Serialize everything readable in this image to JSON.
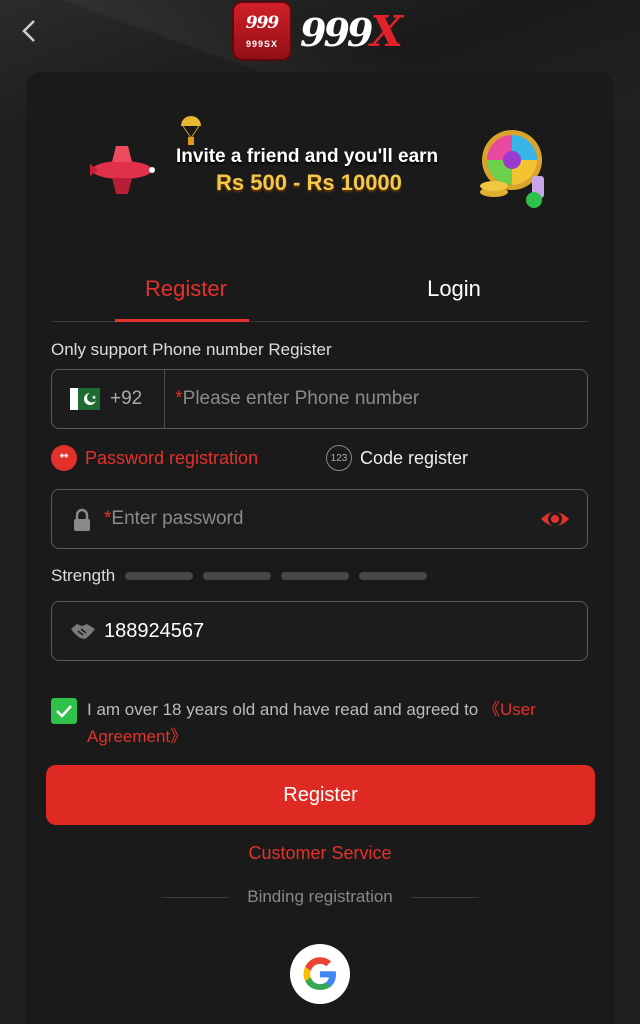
{
  "header": {
    "back_icon": "chevron-left-icon",
    "logo_badge_number": "999",
    "logo_badge_sub": "999SX",
    "logo_text_main": "999",
    "logo_text_x": "X"
  },
  "banner": {
    "invite_text": "Invite a friend and you'll earn",
    "amount_text": "Rs 500 - Rs 10000"
  },
  "tabs": [
    {
      "label": "Register",
      "active": true
    },
    {
      "label": "Login",
      "active": false
    }
  ],
  "form": {
    "support_text": "Only support Phone number Register",
    "country_code": "+92",
    "required_mark": "*",
    "phone_placeholder": "Please enter Phone number",
    "mode_password_label": "Password registration",
    "mode_password_badge": "**",
    "mode_code_label": "Code register",
    "mode_code_badge": "123",
    "password_placeholder": "Enter password",
    "strength_label": "Strength",
    "strength_level": 0,
    "strength_segments": 4,
    "invite_code_value": "188924567",
    "agree_text": "I am over 18 years old and have read and agreed to ",
    "agree_link": "《User Agreement》",
    "agree_checked": true
  },
  "actions": {
    "register_button": "Register",
    "customer_service": "Customer Service",
    "binding_label": "Binding registration",
    "google_icon": "google-icon"
  },
  "colors": {
    "accent": "#e2322b",
    "button": "#de2a22",
    "check": "#2ec24b",
    "background": "#1a1a1a"
  }
}
